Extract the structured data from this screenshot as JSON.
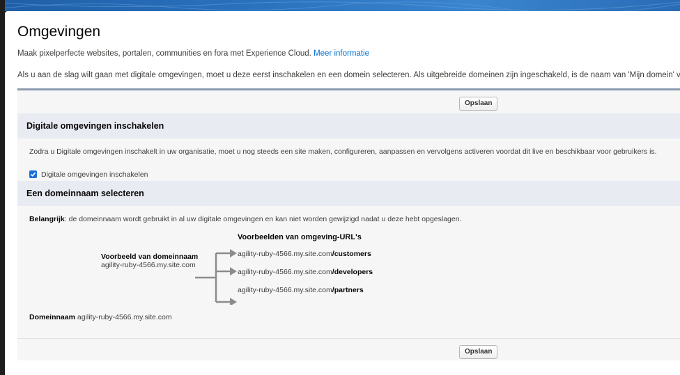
{
  "page": {
    "title": "Omgevingen",
    "intro_text": "Maak pixelperfecte websites, portalen, communities en fora met Experience Cloud.",
    "intro_link": "Meer informatie",
    "intro2_text": "Als u aan de slag wilt gaan met digitale omgevingen, moet u deze eerst inschakelen en een domein selecteren. Als uitgebreide domeinen zijn ingeschakeld, is de naam van 'Mijn domein' va"
  },
  "buttons": {
    "save_top": "Opslaan",
    "save_bottom": "Opslaan"
  },
  "section_enable": {
    "heading": "Digitale omgevingen inschakelen",
    "description": "Zodra u Digitale omgevingen inschakelt in uw organisatie, moet u nog steeds een site maken, configureren, aanpassen en vervolgens activeren voordat dit live en beschikbaar voor gebruikers is.",
    "checkbox_label": "Digitale omgevingen inschakelen",
    "checkbox_checked": true
  },
  "section_domain": {
    "heading": "Een domeinnaam selecteren",
    "important_label": "Belangrijk",
    "important_text": ": de domeinnaam wordt gebruikt in al uw digitale omgevingen en kan niet worden gewijzigd nadat u deze hebt opgeslagen.",
    "example_domain_title": "Voorbeeld van domeinnaam",
    "example_domain_value": "agility-ruby-4566.my.site.com",
    "example_urls_title": "Voorbeelden van omgeving-URL's",
    "url_base": "agility-ruby-4566.my.site.com",
    "urls": [
      {
        "path": "/customers"
      },
      {
        "path": "/developers"
      },
      {
        "path": "/partners"
      }
    ],
    "domain_label": "Domeinnaam",
    "domain_value": "agility-ruby-4566.my.site.com"
  },
  "colors": {
    "accent": "#1b6fd8",
    "link": "#0070d2",
    "section_header": "#e9ebf3"
  }
}
